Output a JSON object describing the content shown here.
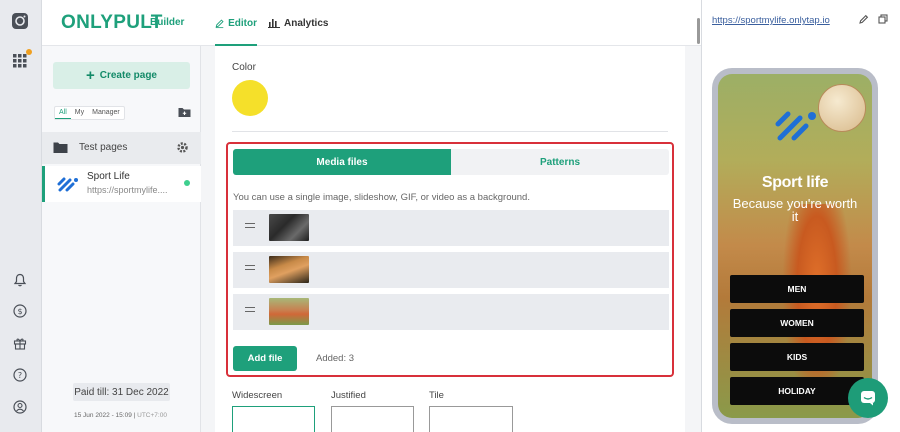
{
  "brand": {
    "name": "ONLYPULT",
    "suffix": "Builder"
  },
  "pages_panel": {
    "create_label": "Create page",
    "filters": [
      "All",
      "My",
      "Manager"
    ],
    "folder": {
      "label": "Test pages"
    },
    "page": {
      "name": "Sport Life",
      "url": "https://sportmylife...."
    },
    "paid_till": "Paid till: 31 Dec 2022",
    "timestamp": "15 Jun 2022 - 15:09",
    "timezone": "UTC+7:00"
  },
  "editor": {
    "tabs": [
      {
        "label": "Editor",
        "icon": "pencil-icon"
      },
      {
        "label": "Analytics",
        "icon": "bar-chart-icon"
      }
    ],
    "color_label": "Color",
    "color_value": "#f5e02a",
    "media": {
      "tabs": [
        "Media files",
        "Patterns"
      ],
      "hint": "You can use a single image, slideshow, GIF, or video as a background.",
      "thumbnails": [
        "#3a3a3a",
        "#b87838",
        "#d07040"
      ],
      "add_label": "Add file",
      "added_text": "Added: 3"
    },
    "layouts": [
      "Widescreen",
      "Justified",
      "Tile"
    ]
  },
  "preview": {
    "url": "https://sportmylife.onlytap.io",
    "title": "Sport life",
    "subtitle": "Because you're worth it",
    "buttons": [
      "MEN",
      "WOMEN",
      "KIDS",
      "HOLIDAY"
    ]
  },
  "colors": {
    "accent": "#1ea07b",
    "highlight": "#d8303a"
  }
}
